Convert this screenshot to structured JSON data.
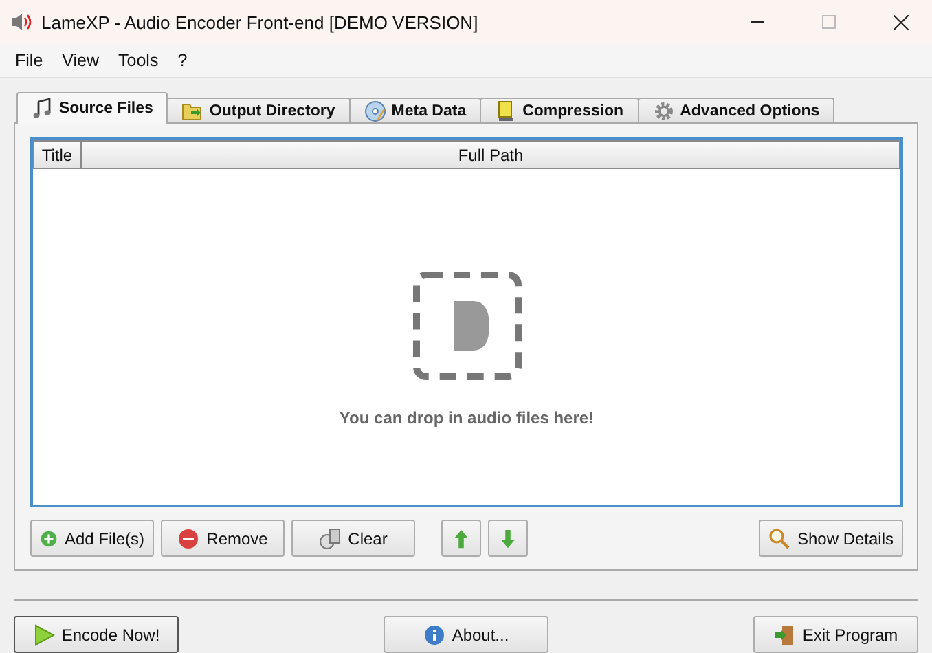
{
  "window": {
    "title": "LameXP - Audio Encoder Front-end [DEMO VERSION]"
  },
  "menu": [
    "File",
    "View",
    "Tools",
    "?"
  ],
  "tabs": [
    {
      "label": "Source Files",
      "selected": true
    },
    {
      "label": "Output Directory",
      "selected": false
    },
    {
      "label": "Meta Data",
      "selected": false
    },
    {
      "label": "Compression",
      "selected": false
    },
    {
      "label": "Advanced Options",
      "selected": false
    }
  ],
  "table": {
    "columns": [
      "Title",
      "Full Path"
    ],
    "empty_hint": "You can drop in audio files here!"
  },
  "list_buttons": [
    "Add File(s)",
    "Remove",
    "Clear"
  ],
  "details_button": "Show Details",
  "bottom_buttons": [
    {
      "label": "Encode Now!",
      "selected": true
    },
    {
      "label": "About...",
      "selected": false
    },
    {
      "label": "Exit Program",
      "selected": false
    }
  ]
}
